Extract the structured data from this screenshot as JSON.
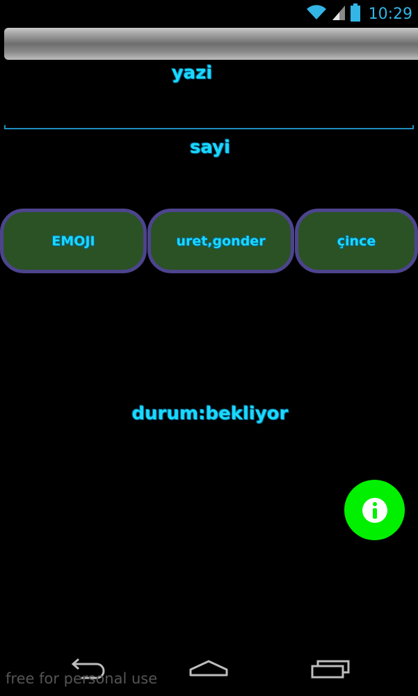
{
  "status_bar": {
    "time": "10:29"
  },
  "form": {
    "label_text": "yazi",
    "input_value": "",
    "label_number": "sayi"
  },
  "buttons": [
    {
      "label": "EMOJI"
    },
    {
      "label": "uret,gonder"
    },
    {
      "label": "çince"
    }
  ],
  "status": "durum:bekliyor",
  "watermark": "free for personal use",
  "colors": {
    "text_glow": "#18e4ff",
    "button_fill": "#2b5224",
    "button_border": "#4d448e",
    "fab": "#00f000",
    "status_bar_icons": "#33b5e5"
  },
  "icons": {
    "fab": "info-icon",
    "nav": [
      "back-icon",
      "home-icon",
      "recent-apps-icon"
    ],
    "status": [
      "wifi-icon",
      "signal-icon",
      "battery-icon"
    ]
  }
}
